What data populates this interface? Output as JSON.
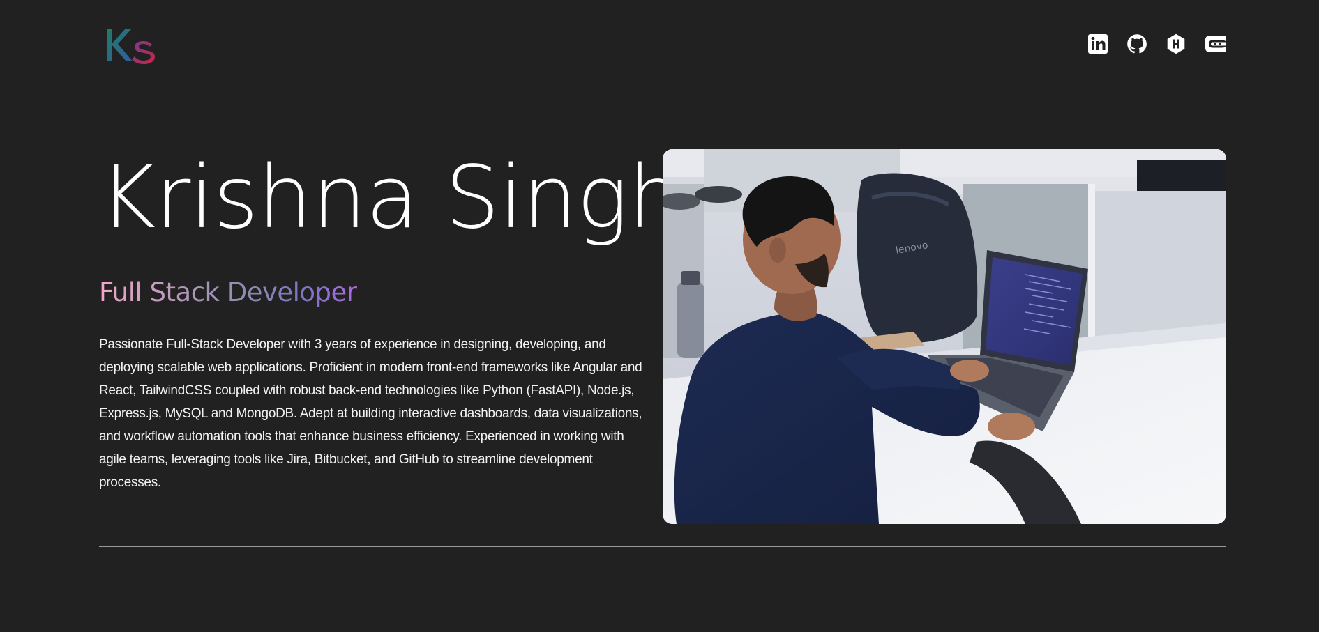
{
  "header": {
    "logo_text": "Ks",
    "socials": [
      {
        "name": "linkedin",
        "icon": "linkedin-icon"
      },
      {
        "name": "github",
        "icon": "github-icon"
      },
      {
        "name": "hashnode",
        "icon": "hashnode-icon"
      },
      {
        "name": "codewars",
        "icon": "codewars-icon"
      }
    ]
  },
  "hero": {
    "name": "Krishna Singh",
    "role": "Full Stack Developer",
    "bio": "Passionate Full-Stack Developer with 3 years of experience in designing, developing, and deploying scalable web applications. Proficient in modern front-end frameworks like Angular and React, TailwindCSS coupled with robust back-end technologies like Python (FastAPI), Node.js, Express.js, MySQL and MongoDB. Adept at building interactive dashboards, data visualizations, and workflow automation tools that enhance business efficiency. Experienced in working with agile teams, leveraging tools like Jira, Bitbucket, and GitHub to streamline development processes.",
    "photo_brand": "lenovo"
  },
  "colors": {
    "background": "#212121",
    "text": "#ffffff",
    "role_gradient": [
      "#f3a6c8",
      "#8d8fb0",
      "#a96be0"
    ],
    "logo_k": "#2f7d7a",
    "logo_s": "#b02a4f"
  }
}
